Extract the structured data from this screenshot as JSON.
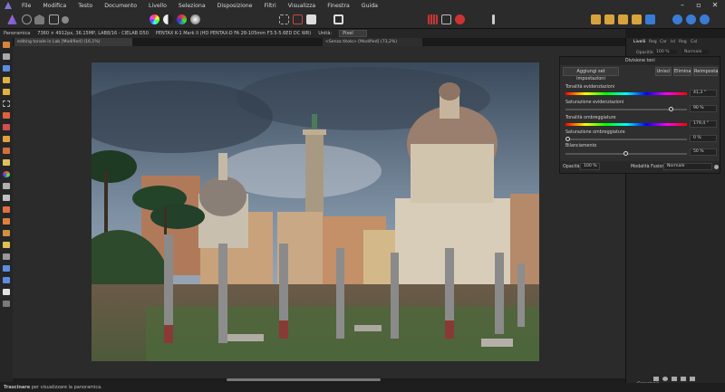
{
  "menu": [
    "File",
    "Modifica",
    "Testo",
    "Documento",
    "Livello",
    "Seleziona",
    "Disposizione",
    "Filtri",
    "Visualizza",
    "Finestra",
    "Guida"
  ],
  "context_bar": {
    "mode": "Panoramica",
    "image_info": "7360 × 4912px, 36.15MP, LAB8/16 - CIELAB D50",
    "camera_info": "PENTAX K-1 Mark II (HD PENTAX-D FA 28-105mm F3.5-5.6ED DC WR)",
    "units_label": "Unità:",
    "units_value": "Pixel"
  },
  "tabs": {
    "doc1": "editing tonale in Lab [Modified] (16,1%)",
    "doc2": "<Senza titolo> [Modified] (73,2%)"
  },
  "right_panel": {
    "tabs": [
      "Livelli",
      "Reg",
      "Car",
      "Isl",
      "Reg",
      "Col"
    ],
    "opacity_label": "Opacità:",
    "opacity_value": "100 %",
    "blend_value": "Normale",
    "history_label": "Cronologia"
  },
  "dialog": {
    "title": "Divisione toni",
    "add_preset": "Aggiungi set impostazioni",
    "merge": "Unisci",
    "delete": "Elimina",
    "reset": "Reimposta",
    "params": [
      {
        "label": "Tonalità evidenziazioni",
        "value": "41,3 °"
      },
      {
        "label": "Saturazione evidenziazioni",
        "value": "90 %"
      },
      {
        "label": "Tonalità ombreggiature",
        "value": "179,4 °"
      },
      {
        "label": "Saturazione ombreggiature",
        "value": "0 %"
      },
      {
        "label": "Bilanciamento",
        "value": "50 %"
      }
    ],
    "opacity_label": "Opacità:",
    "opacity_value": "100 %",
    "blend_label": "Modalità Fusione:",
    "blend_value": "Normale"
  },
  "status": {
    "bold": "Trascinare",
    "text": "per visualizzare la panoramica."
  }
}
